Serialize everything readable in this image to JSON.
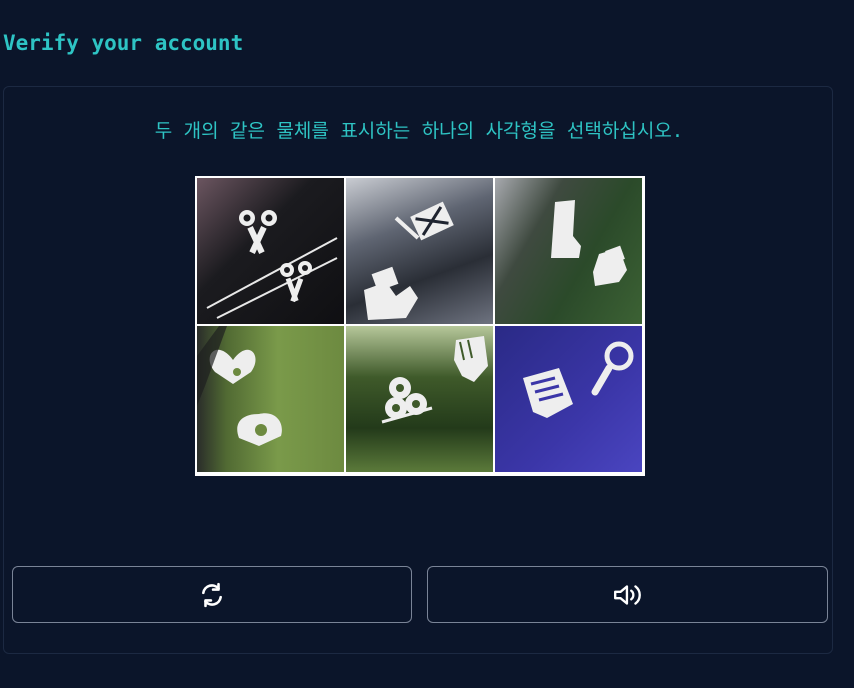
{
  "header": {
    "title": "Verify your account"
  },
  "challenge": {
    "instruction": "두 개의 같은 물체를 표시하는 하나의 사각형을 선택하십시오.",
    "tiles": [
      {
        "name": "scissors-scissors"
      },
      {
        "name": "sled-boot"
      },
      {
        "name": "boot-boot"
      },
      {
        "name": "heart-pin"
      },
      {
        "name": "reels-glove"
      },
      {
        "name": "basket-magnifier"
      }
    ]
  },
  "buttons": {
    "refresh_icon": "refresh-icon",
    "audio_icon": "speaker-icon"
  },
  "colors": {
    "background": "#0b152a",
    "accent": "#2ec4c4",
    "border": "#7a8497"
  }
}
